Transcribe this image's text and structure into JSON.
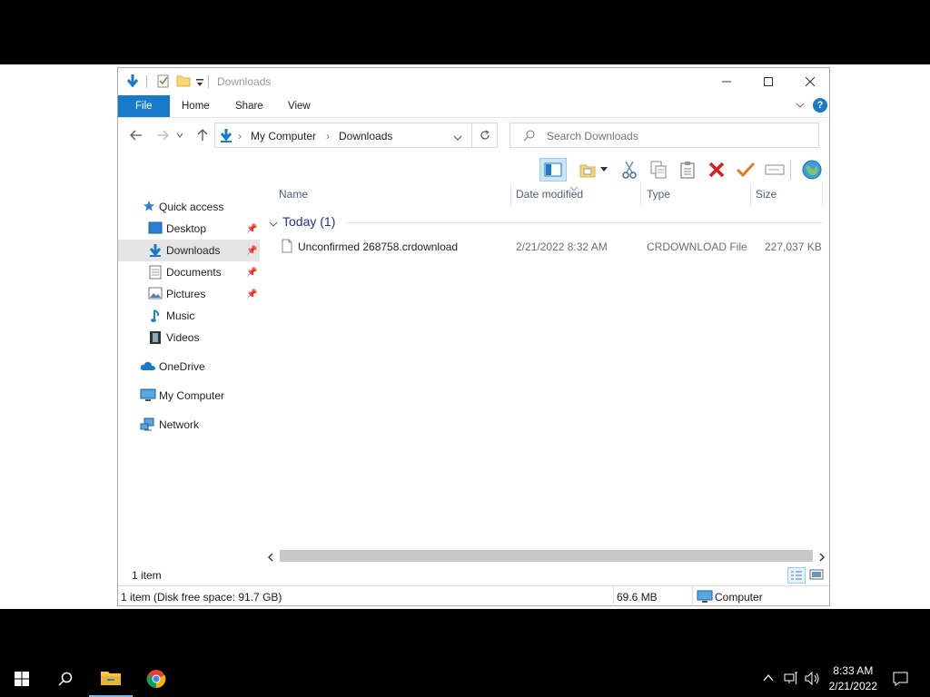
{
  "window": {
    "title": "Downloads",
    "controls": {
      "minimize": "minimize-icon",
      "maximize": "maximize-icon",
      "close": "close-icon"
    }
  },
  "ribbon": {
    "tabs": [
      {
        "label": "File"
      },
      {
        "label": "Home"
      },
      {
        "label": "Share"
      },
      {
        "label": "View"
      }
    ]
  },
  "address": {
    "crumbs": [
      "My Computer",
      "Downloads"
    ]
  },
  "search": {
    "placeholder": "Search Downloads"
  },
  "sidebar": {
    "items": [
      {
        "label": "Quick access",
        "icon": "star-icon"
      },
      {
        "label": "Desktop",
        "icon": "desktop-folder-icon"
      },
      {
        "label": "Downloads",
        "icon": "download-arrow-icon"
      },
      {
        "label": "Documents",
        "icon": "documents-icon"
      },
      {
        "label": "Pictures",
        "icon": "pictures-icon"
      },
      {
        "label": "Music",
        "icon": "music-note-icon"
      },
      {
        "label": "Videos",
        "icon": "film-icon"
      },
      {
        "label": "OneDrive",
        "icon": "cloud-icon"
      },
      {
        "label": "My Computer",
        "icon": "computer-icon"
      },
      {
        "label": "Network",
        "icon": "network-icon"
      }
    ]
  },
  "columns": {
    "name": "Name",
    "date": "Date modified",
    "type": "Type",
    "size": "Size"
  },
  "group": {
    "label": "Today (1)"
  },
  "files": [
    {
      "name": "Unconfirmed 268758.crdownload",
      "date": "2/21/2022 8:32 AM",
      "type": "CRDOWNLOAD File",
      "size": "227,037 KB"
    }
  ],
  "status": {
    "item_count": "1 item",
    "disk_info": "1 item (Disk free space: 91.7 GB)",
    "size_total": "69.6 MB",
    "location": "Computer"
  },
  "taskbar": {
    "time": "8:33 AM",
    "date": "2/21/2022"
  },
  "colors": {
    "accent": "#1979ca",
    "selection": "#e5e5e5",
    "header_text": "#4c607a",
    "group_text": "#1e3287"
  }
}
